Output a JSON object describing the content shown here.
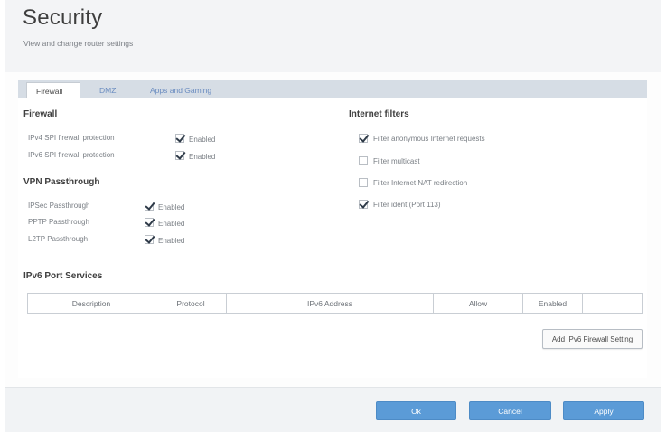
{
  "header": {
    "title": "Security",
    "subtitle": "View and change router settings"
  },
  "tabs": [
    {
      "label": "Firewall",
      "active": true
    },
    {
      "label": "DMZ",
      "active": false
    },
    {
      "label": "Apps and Gaming",
      "active": false
    }
  ],
  "firewall": {
    "title": "Firewall",
    "rows": [
      {
        "label": "IPv4 SPI firewall protection",
        "checked": true,
        "value": "Enabled"
      },
      {
        "label": "IPv6 SPI firewall protection",
        "checked": true,
        "value": "Enabled"
      }
    ]
  },
  "vpn": {
    "title": "VPN Passthrough",
    "rows": [
      {
        "label": "IPSec Passthrough",
        "checked": true,
        "value": "Enabled"
      },
      {
        "label": "PPTP Passthrough",
        "checked": true,
        "value": "Enabled"
      },
      {
        "label": "L2TP Passthrough",
        "checked": true,
        "value": "Enabled"
      }
    ]
  },
  "internet_filters": {
    "title": "Internet filters",
    "items": [
      {
        "label": "Filter anonymous Internet requests",
        "checked": true
      },
      {
        "label": "Filter multicast",
        "checked": false
      },
      {
        "label": "Filter Internet NAT redirection",
        "checked": false
      },
      {
        "label": "Filter ident (Port 113)",
        "checked": true
      }
    ]
  },
  "ipv6": {
    "title": "IPv6 Port Services",
    "columns": [
      "Description",
      "Protocol",
      "IPv6 Address",
      "Allow",
      "Enabled",
      ""
    ],
    "add_button": "Add IPv6 Firewall Setting"
  },
  "footer": {
    "ok": "Ok",
    "cancel": "Cancel",
    "apply": "Apply"
  },
  "colors": {
    "accent": "#5b9bd7",
    "tab_band": "#d6dde5",
    "header_bg": "#f3f4f6"
  }
}
